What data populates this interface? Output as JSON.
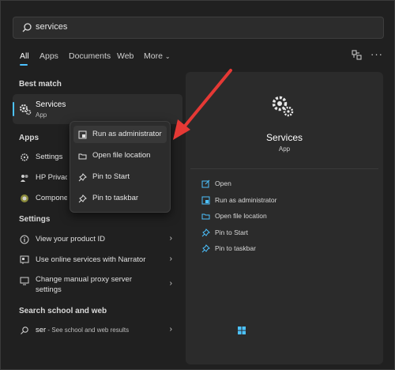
{
  "search": {
    "query": "services"
  },
  "tabs": [
    {
      "label": "All"
    },
    {
      "label": "Apps"
    },
    {
      "label": "Documents"
    },
    {
      "label": "Web"
    },
    {
      "label": "More"
    }
  ],
  "sections": {
    "best_match": "Best match",
    "apps": "Apps",
    "settings": "Settings",
    "search_web": "Search school and web"
  },
  "best_match": {
    "name": "Services",
    "type": "App"
  },
  "apps_list": [
    {
      "label": "Settings"
    },
    {
      "label": "HP Privacy"
    },
    {
      "label": "Componer"
    }
  ],
  "settings_list": [
    {
      "label": "View your product ID"
    },
    {
      "label": "Use online services with Narrator"
    },
    {
      "label_line1": "Change manual proxy server",
      "label_line2": "settings"
    }
  ],
  "web_search": {
    "term": "ser",
    "suffix": " - See school and web results"
  },
  "context_menu": [
    {
      "label": "Run as administrator"
    },
    {
      "label": "Open file location"
    },
    {
      "label": "Pin to Start"
    },
    {
      "label": "Pin to taskbar"
    }
  ],
  "details": {
    "title": "Services",
    "subtitle": "App",
    "actions": [
      {
        "label": "Open"
      },
      {
        "label": "Run as administrator"
      },
      {
        "label": "Open file location"
      },
      {
        "label": "Pin to Start"
      },
      {
        "label": "Pin to taskbar"
      }
    ]
  },
  "colors": {
    "accent": "#4cc2ff",
    "annotation_arrow": "#e53935"
  },
  "icons": {
    "search": "search-icon",
    "gear": "gear-icon",
    "shield": "shield-icon",
    "folder": "folder-icon",
    "pin": "pin-icon",
    "chevron": "chevron-right-icon",
    "more": "ellipsis-icon",
    "people": "people-icon"
  }
}
